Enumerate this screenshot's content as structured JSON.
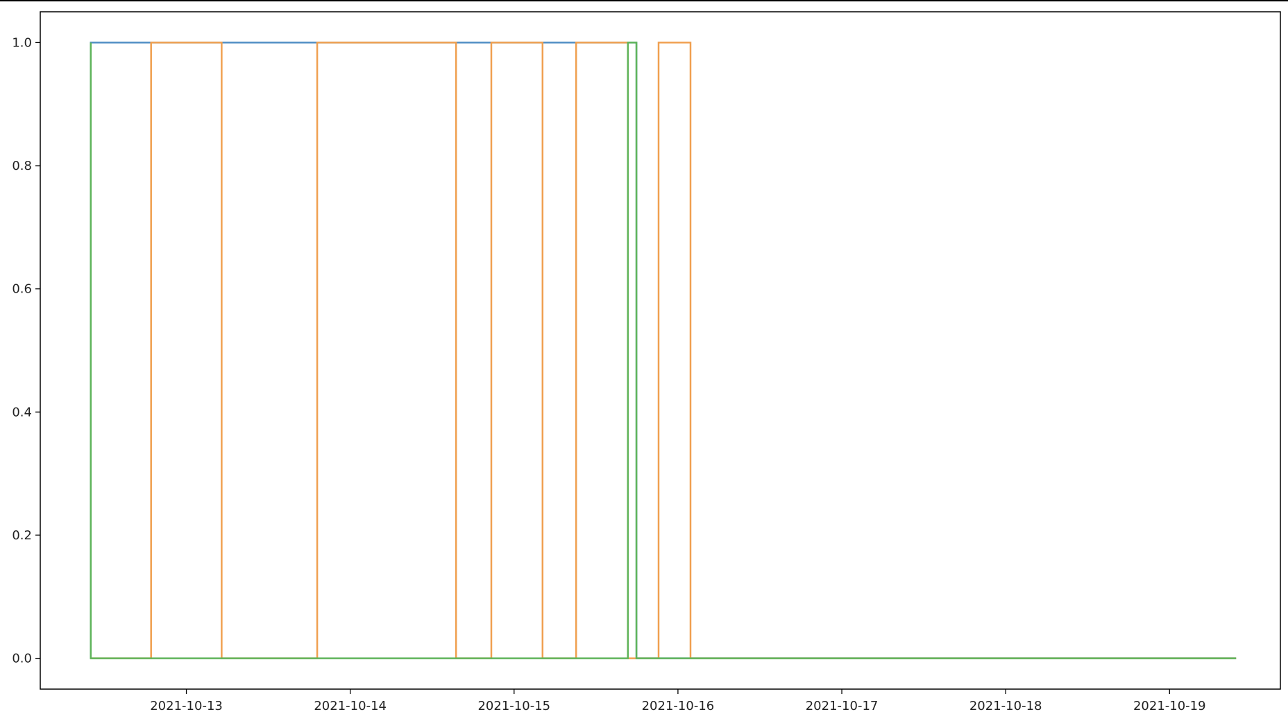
{
  "chart_data": {
    "type": "line",
    "title": "",
    "xlabel": "",
    "ylabel": "",
    "x_axis_type": "date",
    "xlim": [
      "2021-10-12 02:36",
      "2021-10-19 16:14"
    ],
    "ylim": [
      -0.05,
      1.05
    ],
    "x_ticks": [
      "2021-10-13",
      "2021-10-14",
      "2021-10-15",
      "2021-10-16",
      "2021-10-17",
      "2021-10-18",
      "2021-10-19"
    ],
    "y_ticks": [
      0.0,
      0.2,
      0.4,
      0.6,
      0.8,
      1.0
    ],
    "y_tick_labels": [
      "0.0",
      "0.2",
      "0.4",
      "0.6",
      "0.8",
      "1.0"
    ],
    "grid": false,
    "legend": false,
    "series": [
      {
        "color": "#4f8ec4",
        "x": [
          "2021-10-12 10:00",
          "2021-10-12 10:00",
          "2021-10-15 17:55",
          "2021-10-15 17:55",
          "2021-10-19 09:45"
        ],
        "values": [
          0,
          1,
          1,
          0,
          0
        ]
      },
      {
        "color": "#f0a050",
        "x": [
          "2021-10-12 10:00",
          "2021-10-12 18:50",
          "2021-10-12 18:50",
          "2021-10-13 05:10",
          "2021-10-13 05:10",
          "2021-10-13 19:10",
          "2021-10-13 19:10",
          "2021-10-14 15:30",
          "2021-10-14 15:30",
          "2021-10-14 20:40",
          "2021-10-14 20:40",
          "2021-10-15 04:10",
          "2021-10-15 04:10",
          "2021-10-15 09:05",
          "2021-10-15 09:05",
          "2021-10-15 16:40",
          "2021-10-15 16:40",
          "2021-10-15 21:10",
          "2021-10-15 21:10",
          "2021-10-16 01:50",
          "2021-10-16 01:50",
          "2021-10-19 09:45"
        ],
        "values": [
          0,
          0,
          1,
          1,
          0,
          0,
          1,
          1,
          0,
          0,
          1,
          1,
          0,
          0,
          1,
          1,
          0,
          0,
          1,
          1,
          0,
          0
        ]
      },
      {
        "color": "#5fb45a",
        "x": [
          "2021-10-12 10:00",
          "2021-10-12 10:00",
          "2021-10-12 10:00",
          "2021-10-15 16:40",
          "2021-10-15 16:40",
          "2021-10-15 17:55",
          "2021-10-15 17:55",
          "2021-10-19 09:45"
        ],
        "values": [
          1,
          0,
          0,
          0,
          1,
          1,
          0,
          0
        ]
      }
    ]
  }
}
